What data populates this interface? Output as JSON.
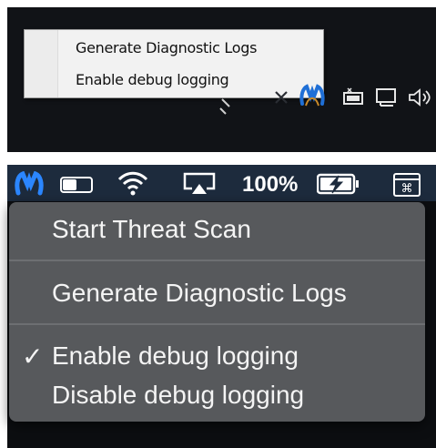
{
  "windows_context_menu": {
    "items": [
      {
        "label": "Generate Diagnostic Logs"
      },
      {
        "label": "Enable debug logging"
      }
    ]
  },
  "windows_tray": {
    "icons": [
      "pen-icon",
      "x-icon",
      "malwarebytes-icon",
      "battery-icon",
      "network-icon",
      "volume-icon"
    ]
  },
  "mac_menubar": {
    "battery_percent": "100%",
    "icons": [
      "malwarebytes-icon",
      "toggle-icon",
      "wifi-icon",
      "airplay-icon",
      "battery-charging-icon",
      "command-icon"
    ]
  },
  "mac_menu": {
    "items": [
      {
        "label": "Start Threat Scan"
      },
      {
        "label": "Generate Diagnostic Logs"
      },
      {
        "label": "Enable debug logging",
        "checked": true
      },
      {
        "label": "Disable debug logging",
        "checked": false
      }
    ],
    "check_glyph": "✓"
  },
  "colors": {
    "taskbar_bg": "#111317",
    "menubar_bg": "#1d2b3d",
    "mac_menu_bg": "#57595c",
    "malwarebytes_blue": "#1f7ae0"
  }
}
